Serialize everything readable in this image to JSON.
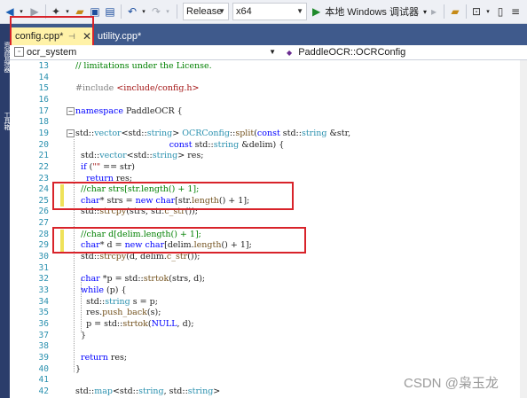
{
  "toolbar": {
    "configuration": "Release",
    "platform": "x64",
    "run_label": "本地 Windows 调试器"
  },
  "left_strip": {
    "items": [
      "资源管理器",
      "工具箱"
    ]
  },
  "tabs": [
    {
      "label": "config.cpp*",
      "active": true
    },
    {
      "label": "utility.cpp*",
      "active": false
    }
  ],
  "navbar": {
    "scope": "ocr_system",
    "member": "PaddleOCR::OCRConfig"
  },
  "editor": {
    "lines": [
      {
        "no": "13",
        "tokens": [
          {
            "t": "// limitations under the License.",
            "c": "cm"
          }
        ]
      },
      {
        "no": "14",
        "tokens": []
      },
      {
        "no": "15",
        "tokens": [
          {
            "t": "#include ",
            "c": "pp"
          },
          {
            "t": "<include/config.h>",
            "c": "st"
          }
        ]
      },
      {
        "no": "16",
        "tokens": []
      },
      {
        "no": "17",
        "tokens": [
          {
            "t": "namespace",
            "c": "kw"
          },
          {
            "t": " PaddleOCR {",
            "c": ""
          }
        ]
      },
      {
        "no": "18",
        "tokens": []
      },
      {
        "no": "19",
        "tokens": [
          {
            "t": "std::",
            "c": ""
          },
          {
            "t": "vector",
            "c": "ty"
          },
          {
            "t": "<std::",
            "c": ""
          },
          {
            "t": "string",
            "c": "ty"
          },
          {
            "t": "> ",
            "c": ""
          },
          {
            "t": "OCRConfig",
            "c": "ty"
          },
          {
            "t": "::",
            "c": ""
          },
          {
            "t": "split",
            "c": "fn"
          },
          {
            "t": "(",
            "c": ""
          },
          {
            "t": "const",
            "c": "kw"
          },
          {
            "t": " std::",
            "c": ""
          },
          {
            "t": "string",
            "c": "ty"
          },
          {
            "t": " &str,",
            "c": ""
          }
        ]
      },
      {
        "no": "20",
        "tokens": [
          {
            "t": "                                   ",
            "c": ""
          },
          {
            "t": "const",
            "c": "kw"
          },
          {
            "t": " std::",
            "c": ""
          },
          {
            "t": "string",
            "c": "ty"
          },
          {
            "t": " &delim) {",
            "c": ""
          }
        ]
      },
      {
        "no": "21",
        "tokens": [
          {
            "t": "  std::",
            "c": ""
          },
          {
            "t": "vector",
            "c": "ty"
          },
          {
            "t": "<std::",
            "c": ""
          },
          {
            "t": "string",
            "c": "ty"
          },
          {
            "t": "> res;",
            "c": ""
          }
        ]
      },
      {
        "no": "22",
        "tokens": [
          {
            "t": "  ",
            "c": ""
          },
          {
            "t": "if",
            "c": "kw"
          },
          {
            "t": " (",
            "c": ""
          },
          {
            "t": "\"\"",
            "c": "st"
          },
          {
            "t": " == str)",
            "c": ""
          }
        ]
      },
      {
        "no": "23",
        "tokens": [
          {
            "t": "    ",
            "c": ""
          },
          {
            "t": "return",
            "c": "kw"
          },
          {
            "t": " res;",
            "c": ""
          }
        ]
      },
      {
        "no": "24",
        "tokens": [
          {
            "t": "  //char strs[str.length() + 1];",
            "c": "cm"
          }
        ]
      },
      {
        "no": "25",
        "tokens": [
          {
            "t": "  ",
            "c": ""
          },
          {
            "t": "char",
            "c": "kw"
          },
          {
            "t": "* strs = ",
            "c": ""
          },
          {
            "t": "new",
            "c": "kw"
          },
          {
            "t": " ",
            "c": ""
          },
          {
            "t": "char",
            "c": "kw"
          },
          {
            "t": "[str.",
            "c": ""
          },
          {
            "t": "length",
            "c": "fn"
          },
          {
            "t": "() + 1];",
            "c": ""
          }
        ]
      },
      {
        "no": "26",
        "tokens": [
          {
            "t": "  std::",
            "c": ""
          },
          {
            "t": "strcpy",
            "c": "fn"
          },
          {
            "t": "(strs, str.",
            "c": ""
          },
          {
            "t": "c_str",
            "c": "fn"
          },
          {
            "t": "());",
            "c": ""
          }
        ]
      },
      {
        "no": "27",
        "tokens": []
      },
      {
        "no": "28",
        "tokens": [
          {
            "t": "  //char d[delim.length() + 1];",
            "c": "cm"
          }
        ]
      },
      {
        "no": "29",
        "tokens": [
          {
            "t": "  ",
            "c": ""
          },
          {
            "t": "char",
            "c": "kw"
          },
          {
            "t": "* d = ",
            "c": ""
          },
          {
            "t": "new",
            "c": "kw"
          },
          {
            "t": " ",
            "c": ""
          },
          {
            "t": "char",
            "c": "kw"
          },
          {
            "t": "[delim.",
            "c": ""
          },
          {
            "t": "length",
            "c": "fn"
          },
          {
            "t": "() + 1];",
            "c": ""
          }
        ]
      },
      {
        "no": "30",
        "tokens": [
          {
            "t": "  std::",
            "c": ""
          },
          {
            "t": "strcpy",
            "c": "fn"
          },
          {
            "t": "(d, delim.",
            "c": ""
          },
          {
            "t": "c_str",
            "c": "fn"
          },
          {
            "t": "());",
            "c": ""
          }
        ]
      },
      {
        "no": "31",
        "tokens": []
      },
      {
        "no": "32",
        "tokens": [
          {
            "t": "  ",
            "c": ""
          },
          {
            "t": "char",
            "c": "kw"
          },
          {
            "t": " *p = std::",
            "c": ""
          },
          {
            "t": "strtok",
            "c": "fn"
          },
          {
            "t": "(strs, d);",
            "c": ""
          }
        ]
      },
      {
        "no": "33",
        "tokens": [
          {
            "t": "  ",
            "c": ""
          },
          {
            "t": "while",
            "c": "kw"
          },
          {
            "t": " (p) {",
            "c": ""
          }
        ]
      },
      {
        "no": "34",
        "tokens": [
          {
            "t": "    std::",
            "c": ""
          },
          {
            "t": "string",
            "c": "ty"
          },
          {
            "t": " s = p;",
            "c": ""
          }
        ]
      },
      {
        "no": "35",
        "tokens": [
          {
            "t": "    res.",
            "c": ""
          },
          {
            "t": "push_back",
            "c": "fn"
          },
          {
            "t": "(s);",
            "c": ""
          }
        ]
      },
      {
        "no": "36",
        "tokens": [
          {
            "t": "    p = std::",
            "c": ""
          },
          {
            "t": "strtok",
            "c": "fn"
          },
          {
            "t": "(",
            "c": ""
          },
          {
            "t": "NULL",
            "c": "kw"
          },
          {
            "t": ", d);",
            "c": ""
          }
        ]
      },
      {
        "no": "37",
        "tokens": [
          {
            "t": "  }",
            "c": ""
          }
        ]
      },
      {
        "no": "38",
        "tokens": []
      },
      {
        "no": "39",
        "tokens": [
          {
            "t": "  ",
            "c": ""
          },
          {
            "t": "return",
            "c": "kw"
          },
          {
            "t": " res;",
            "c": ""
          }
        ]
      },
      {
        "no": "40",
        "tokens": [
          {
            "t": "}",
            "c": ""
          }
        ]
      },
      {
        "no": "41",
        "tokens": []
      },
      {
        "no": "42",
        "tokens": [
          {
            "t": "std::",
            "c": ""
          },
          {
            "t": "map",
            "c": "ty"
          },
          {
            "t": "<std::",
            "c": ""
          },
          {
            "t": "string",
            "c": "ty"
          },
          {
            "t": ", std::",
            "c": ""
          },
          {
            "t": "string",
            "c": "ty"
          },
          {
            "t": ">",
            "c": ""
          }
        ]
      }
    ]
  },
  "watermark": "CSDN @枭玉龙",
  "colors": {
    "highlight_box": "#d8232a",
    "change_marker": "#efe25a",
    "active_tab": "#fff2a8",
    "tab_bar": "#3f5a8c",
    "keyword": "#0000ff",
    "type": "#2b91af",
    "comment": "#008000",
    "string": "#a31515"
  }
}
